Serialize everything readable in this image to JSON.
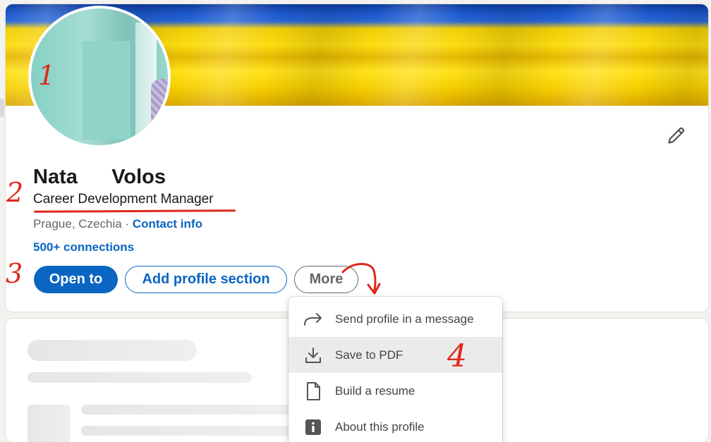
{
  "profile": {
    "first_name": "Nata",
    "last_name": "Volos",
    "headline": "Career Development Manager",
    "location": "Prague, Czechia",
    "separator": " · ",
    "contact_info": "Contact info",
    "connections": "500+ connections"
  },
  "actions": {
    "open_to": "Open to",
    "add_profile_section": "Add profile section",
    "more": "More"
  },
  "more_menu": {
    "items": [
      {
        "label": "Send profile in a message",
        "icon": "share-arrow-icon"
      },
      {
        "label": "Save to PDF",
        "icon": "download-icon",
        "highlighted": true
      },
      {
        "label": "Build a resume",
        "icon": "document-icon"
      },
      {
        "label": "About this profile",
        "icon": "info-icon"
      }
    ]
  },
  "annotations": [
    "1",
    "2",
    "3",
    "4"
  ],
  "colors": {
    "brand_blue": "#0a66c2",
    "annotation_red": "#e0281c",
    "banner_blue": "#2a67d6",
    "banner_yellow": "#f6cf00"
  }
}
